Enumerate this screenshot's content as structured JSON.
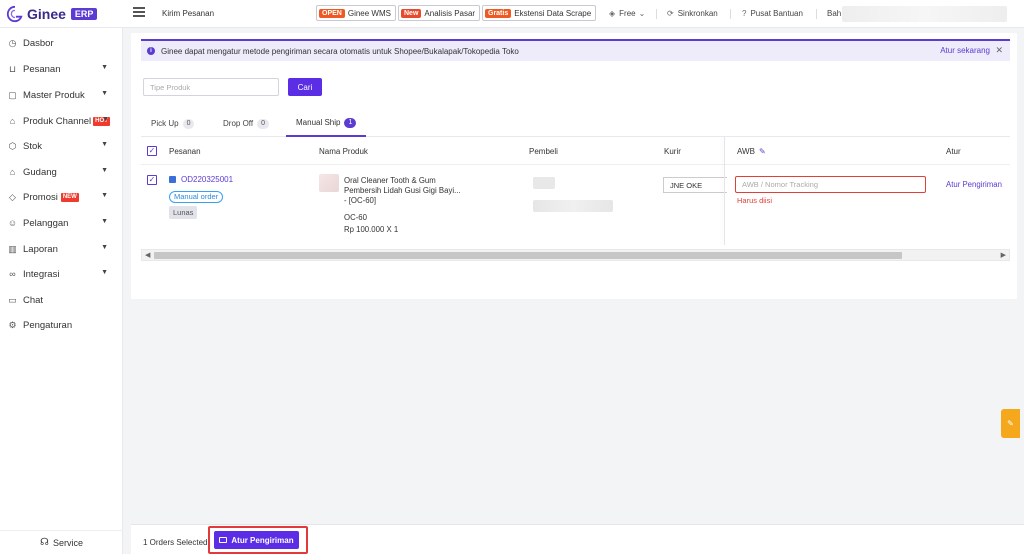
{
  "brand": {
    "name": "Ginee",
    "badge": "ERP"
  },
  "topbar": {
    "page": "Kirim Pesanan",
    "chips": [
      {
        "tag": "OPEN",
        "label": "Ginee WMS"
      },
      {
        "tag": "New",
        "label": "Analisis Pasar"
      },
      {
        "tag": "Gratis",
        "label": "Ekstensi Data Scrape"
      }
    ],
    "plan": "Free",
    "sync": "Sinkronkan",
    "help": "Pusat Bantuan",
    "lang": "Bah"
  },
  "sidebar": {
    "items": [
      {
        "label": "Dasbor",
        "icon": "dashboard-icon",
        "chevron": false
      },
      {
        "label": "Pesanan",
        "icon": "cart-icon",
        "chevron": true
      },
      {
        "label": "Master Produk",
        "icon": "box-icon",
        "chevron": true
      },
      {
        "label": "Produk Channel",
        "icon": "tag-icon",
        "chevron": true,
        "badge": "HOT"
      },
      {
        "label": "Stok",
        "icon": "stock-icon",
        "chevron": true
      },
      {
        "label": "Gudang",
        "icon": "warehouse-icon",
        "chevron": true
      },
      {
        "label": "Promosi",
        "icon": "promo-icon",
        "chevron": true,
        "badge": "NEW"
      },
      {
        "label": "Pelanggan",
        "icon": "users-icon",
        "chevron": true
      },
      {
        "label": "Laporan",
        "icon": "report-icon",
        "chevron": true
      },
      {
        "label": "Integrasi",
        "icon": "link-icon",
        "chevron": true
      },
      {
        "label": "Chat",
        "icon": "chat-icon",
        "chevron": false
      },
      {
        "label": "Pengaturan",
        "icon": "gear-icon",
        "chevron": false
      }
    ],
    "service": "Service"
  },
  "alert": {
    "text": "Ginee dapat mengatur metode pengiriman secara otomatis untuk Shopee/Bukalapak/Tokopedia Toko",
    "action": "Atur sekarang"
  },
  "search": {
    "placeholder": "Tipe Produk",
    "value": "",
    "button": "Cari"
  },
  "tabs": [
    {
      "label": "Pick Up",
      "count": "0"
    },
    {
      "label": "Drop Off",
      "count": "0"
    },
    {
      "label": "Manual Ship",
      "count": "1",
      "active": true
    }
  ],
  "table": {
    "headers": {
      "order": "Pesanan",
      "product": "Nama Produk",
      "buyer": "Pembeli",
      "courier": "Kurir",
      "awb": "AWB",
      "action": "Atur"
    },
    "rows": [
      {
        "order_id": "OD220325001",
        "order_type": "Manual order",
        "payment": "Lunas",
        "product_name": "Oral Cleaner Tooth & Gum Pembersih Lidah Gusi Gigi Bayi...",
        "variant": "- [OC-60]",
        "sku": "OC-60",
        "price_qty": "Rp 100.000 X 1",
        "courier": "JNE OKE",
        "awb_placeholder": "AWB / Nomor Tracking",
        "awb_error": "Harus diisi",
        "action": "Atur Pengiriman"
      }
    ]
  },
  "footer": {
    "selected": "1 Orders Selected",
    "button": "Atur Pengiriman"
  },
  "colors": {
    "accent": "#5b3bd1",
    "primary_button": "#5b2ee6",
    "error": "#e0403a",
    "highlight": "#e23a3a"
  }
}
